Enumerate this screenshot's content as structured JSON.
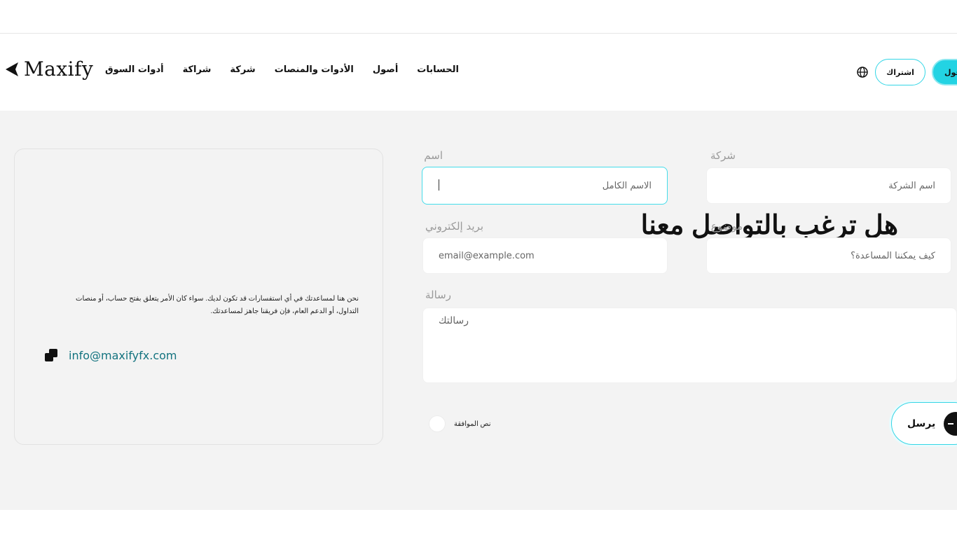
{
  "header": {
    "logo_text": "Maxify",
    "nav_items": [
      "أدوات السوق",
      "شراكة",
      "شركة",
      "الأدوات والمنصات",
      "أصول",
      "الحسابات"
    ],
    "subscribe_label": "اشتراك",
    "login_label": "دخول",
    "globe_icon": "globe-icon"
  },
  "contact_card": {
    "title": "هل ترغب بالتواصل معنا مباشرة؟",
    "body": "نحن هنا لمساعدتك في أي استفسارات قد تكون لديك. سواء كان الأمر يتعلق بفتح حساب، أو منصات التداول، أو الدعم العام، فإن فريقنا جاهز لمساعدتك.",
    "email": "info@maxifyfx.com"
  },
  "form": {
    "name": {
      "label": "اسم",
      "placeholder": "الاسم الكامل",
      "value": ""
    },
    "company": {
      "label": "شركة",
      "placeholder": "اسم الشركة",
      "value": ""
    },
    "email": {
      "label": "بريد إلكتروني",
      "placeholder": "email@example.com",
      "value": ""
    },
    "subject": {
      "label": "موضوع",
      "placeholder": "كيف يمكننا المساعدة؟",
      "value": ""
    },
    "message": {
      "label": "رسالة",
      "placeholder": "رسالتك",
      "value": ""
    },
    "agree_label": "نص الموافقة",
    "send_label": "يرسل"
  },
  "colors": {
    "accent": "#23d3e3",
    "email_link": "#13737f",
    "background": "#f3f3f3"
  }
}
